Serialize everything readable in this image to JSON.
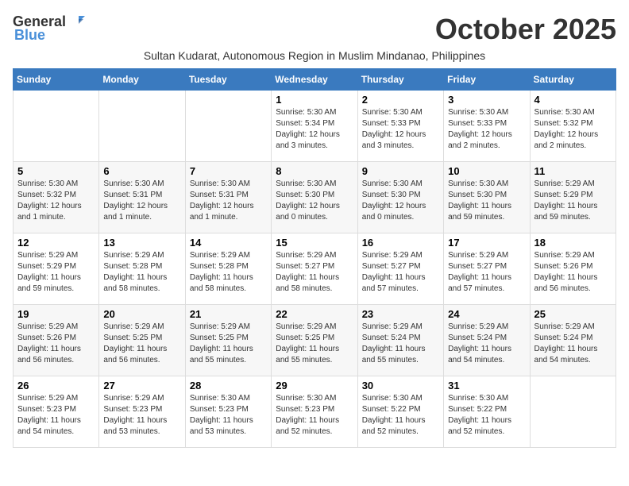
{
  "logo": {
    "general": "General",
    "blue": "Blue"
  },
  "title": "October 2025",
  "subtitle": "Sultan Kudarat, Autonomous Region in Muslim Mindanao, Philippines",
  "headers": [
    "Sunday",
    "Monday",
    "Tuesday",
    "Wednesday",
    "Thursday",
    "Friday",
    "Saturday"
  ],
  "weeks": [
    [
      {
        "day": "",
        "info": ""
      },
      {
        "day": "",
        "info": ""
      },
      {
        "day": "",
        "info": ""
      },
      {
        "day": "1",
        "info": "Sunrise: 5:30 AM\nSunset: 5:34 PM\nDaylight: 12 hours\nand 3 minutes."
      },
      {
        "day": "2",
        "info": "Sunrise: 5:30 AM\nSunset: 5:33 PM\nDaylight: 12 hours\nand 3 minutes."
      },
      {
        "day": "3",
        "info": "Sunrise: 5:30 AM\nSunset: 5:33 PM\nDaylight: 12 hours\nand 2 minutes."
      },
      {
        "day": "4",
        "info": "Sunrise: 5:30 AM\nSunset: 5:32 PM\nDaylight: 12 hours\nand 2 minutes."
      }
    ],
    [
      {
        "day": "5",
        "info": "Sunrise: 5:30 AM\nSunset: 5:32 PM\nDaylight: 12 hours\nand 1 minute."
      },
      {
        "day": "6",
        "info": "Sunrise: 5:30 AM\nSunset: 5:31 PM\nDaylight: 12 hours\nand 1 minute."
      },
      {
        "day": "7",
        "info": "Sunrise: 5:30 AM\nSunset: 5:31 PM\nDaylight: 12 hours\nand 1 minute."
      },
      {
        "day": "8",
        "info": "Sunrise: 5:30 AM\nSunset: 5:30 PM\nDaylight: 12 hours\nand 0 minutes."
      },
      {
        "day": "9",
        "info": "Sunrise: 5:30 AM\nSunset: 5:30 PM\nDaylight: 12 hours\nand 0 minutes."
      },
      {
        "day": "10",
        "info": "Sunrise: 5:30 AM\nSunset: 5:30 PM\nDaylight: 11 hours\nand 59 minutes."
      },
      {
        "day": "11",
        "info": "Sunrise: 5:29 AM\nSunset: 5:29 PM\nDaylight: 11 hours\nand 59 minutes."
      }
    ],
    [
      {
        "day": "12",
        "info": "Sunrise: 5:29 AM\nSunset: 5:29 PM\nDaylight: 11 hours\nand 59 minutes."
      },
      {
        "day": "13",
        "info": "Sunrise: 5:29 AM\nSunset: 5:28 PM\nDaylight: 11 hours\nand 58 minutes."
      },
      {
        "day": "14",
        "info": "Sunrise: 5:29 AM\nSunset: 5:28 PM\nDaylight: 11 hours\nand 58 minutes."
      },
      {
        "day": "15",
        "info": "Sunrise: 5:29 AM\nSunset: 5:27 PM\nDaylight: 11 hours\nand 58 minutes."
      },
      {
        "day": "16",
        "info": "Sunrise: 5:29 AM\nSunset: 5:27 PM\nDaylight: 11 hours\nand 57 minutes."
      },
      {
        "day": "17",
        "info": "Sunrise: 5:29 AM\nSunset: 5:27 PM\nDaylight: 11 hours\nand 57 minutes."
      },
      {
        "day": "18",
        "info": "Sunrise: 5:29 AM\nSunset: 5:26 PM\nDaylight: 11 hours\nand 56 minutes."
      }
    ],
    [
      {
        "day": "19",
        "info": "Sunrise: 5:29 AM\nSunset: 5:26 PM\nDaylight: 11 hours\nand 56 minutes."
      },
      {
        "day": "20",
        "info": "Sunrise: 5:29 AM\nSunset: 5:25 PM\nDaylight: 11 hours\nand 56 minutes."
      },
      {
        "day": "21",
        "info": "Sunrise: 5:29 AM\nSunset: 5:25 PM\nDaylight: 11 hours\nand 55 minutes."
      },
      {
        "day": "22",
        "info": "Sunrise: 5:29 AM\nSunset: 5:25 PM\nDaylight: 11 hours\nand 55 minutes."
      },
      {
        "day": "23",
        "info": "Sunrise: 5:29 AM\nSunset: 5:24 PM\nDaylight: 11 hours\nand 55 minutes."
      },
      {
        "day": "24",
        "info": "Sunrise: 5:29 AM\nSunset: 5:24 PM\nDaylight: 11 hours\nand 54 minutes."
      },
      {
        "day": "25",
        "info": "Sunrise: 5:29 AM\nSunset: 5:24 PM\nDaylight: 11 hours\nand 54 minutes."
      }
    ],
    [
      {
        "day": "26",
        "info": "Sunrise: 5:29 AM\nSunset: 5:23 PM\nDaylight: 11 hours\nand 54 minutes."
      },
      {
        "day": "27",
        "info": "Sunrise: 5:29 AM\nSunset: 5:23 PM\nDaylight: 11 hours\nand 53 minutes."
      },
      {
        "day": "28",
        "info": "Sunrise: 5:30 AM\nSunset: 5:23 PM\nDaylight: 11 hours\nand 53 minutes."
      },
      {
        "day": "29",
        "info": "Sunrise: 5:30 AM\nSunset: 5:23 PM\nDaylight: 11 hours\nand 52 minutes."
      },
      {
        "day": "30",
        "info": "Sunrise: 5:30 AM\nSunset: 5:22 PM\nDaylight: 11 hours\nand 52 minutes."
      },
      {
        "day": "31",
        "info": "Sunrise: 5:30 AM\nSunset: 5:22 PM\nDaylight: 11 hours\nand 52 minutes."
      },
      {
        "day": "",
        "info": ""
      }
    ]
  ]
}
